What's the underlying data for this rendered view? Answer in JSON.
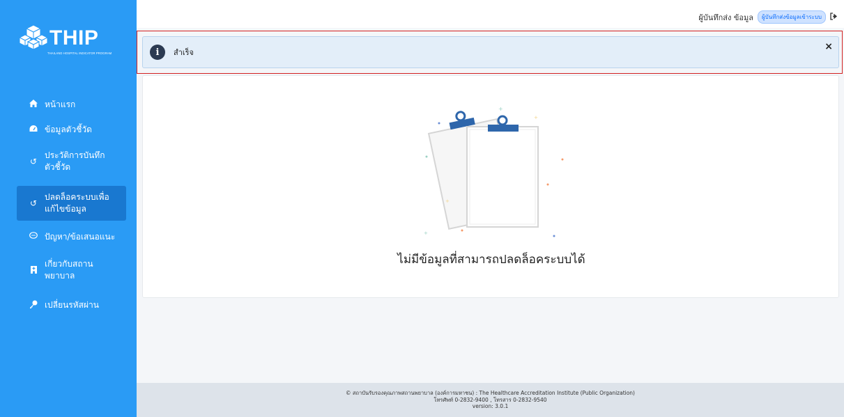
{
  "logo": {
    "title": "THIP",
    "subtitle": "THAILAND HOSPITAL INDICATOR PROGRAM"
  },
  "sidebar": {
    "items": [
      {
        "icon": "home-icon",
        "label": "หน้าแรก"
      },
      {
        "icon": "dashboard-icon",
        "label": "ข้อมูลตัวชี้วัด"
      },
      {
        "icon": "history-icon",
        "label": "ประวัติการบันทึก ตัวชี้วัด"
      },
      {
        "icon": "history-icon",
        "label": "ปลดล็อคระบบเพื่อ แก้ไขข้อมูล"
      },
      {
        "icon": "chat-icon",
        "label": "ปัญหา/ข้อเสนอแนะ"
      },
      {
        "icon": "hospital-icon",
        "label": "เกี่ยวกับสถาน พยาบาล"
      },
      {
        "icon": "key-icon",
        "label": "เปลี่ยนรหัสผ่าน"
      }
    ]
  },
  "header": {
    "user_text": "ผู้บันทึกส่ง ข้อมูล",
    "role_badge": "ผู้บันทึกส่งข้อมูลเข้าระบบ"
  },
  "alert": {
    "message": "สำเร็จ",
    "close": "×"
  },
  "main": {
    "empty_message": "ไม่มีข้อมูลที่สามารถปลดล็อคระบบได้"
  },
  "footer": {
    "line1": "© สถาบันรับรองคุณภาพสถานพยาบาล (องค์การมหาชน) : The Healthcare Accreditation Institute (Public Organization)",
    "line2": "โทรศัพท์ 0-2832-9400 , โทรสาร 0-2832-9540",
    "line3": "version: 3.0.1"
  },
  "colors": {
    "sidebar": "#2a9bf5",
    "sidebar_active": "#1978d0",
    "alert_border": "#d32020",
    "alert_bg": "#e3eef9"
  }
}
